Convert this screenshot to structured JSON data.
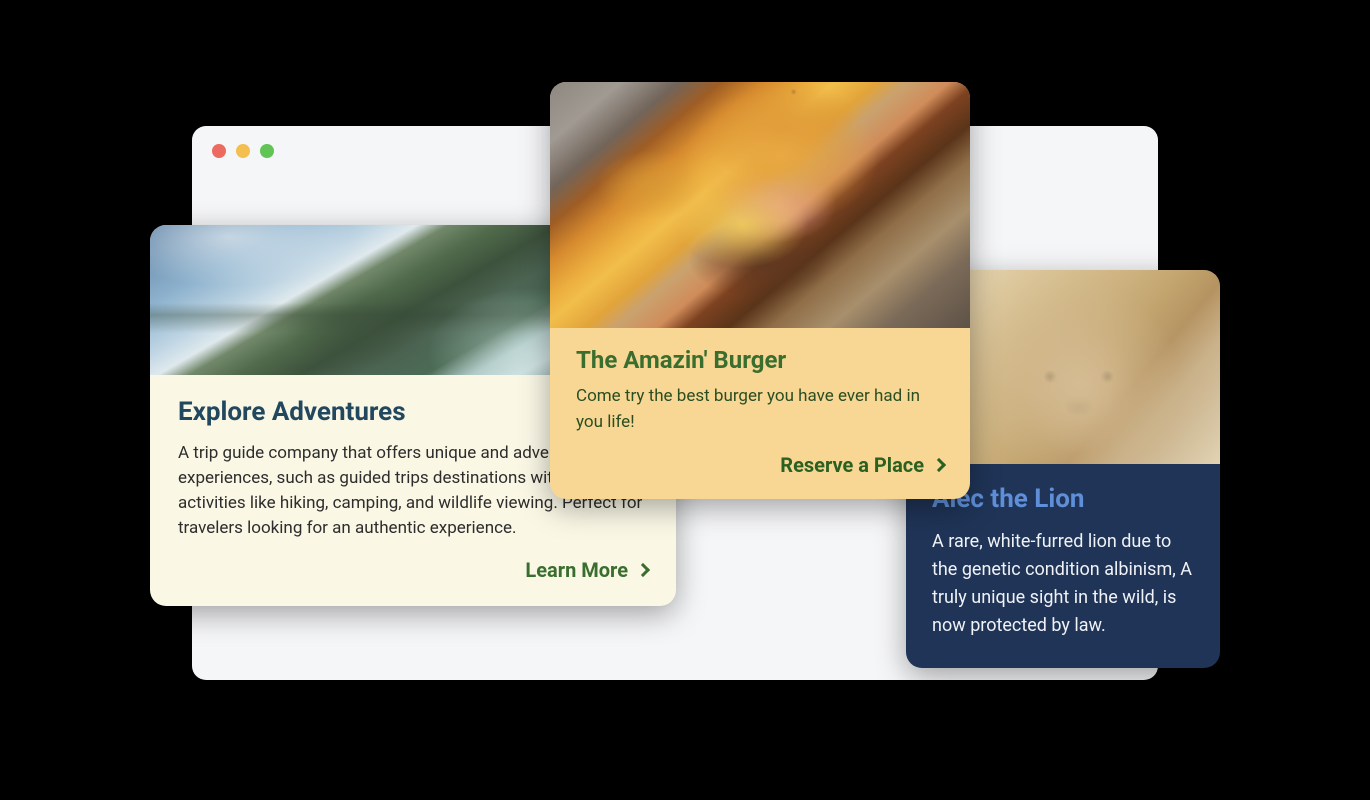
{
  "cards": {
    "adventures": {
      "title": "Explore Adventures",
      "description": "A trip guide company that offers unique and adventure experiences, such as guided trips destinations with outdoor activities like hiking, camping, and wildlife viewing. Perfect for travelers looking for an authentic experience.",
      "action_label": "Learn More"
    },
    "burger": {
      "title": "The Amazin' Burger",
      "description": "Come try the best burger you have ever had in you life!",
      "action_label": "Reserve a Place"
    },
    "lion": {
      "title": "Alec the Lion",
      "description": "A rare, white-furred lion due to the genetic condition albinism, A truly unique sight in the wild, is now protected by law."
    }
  }
}
